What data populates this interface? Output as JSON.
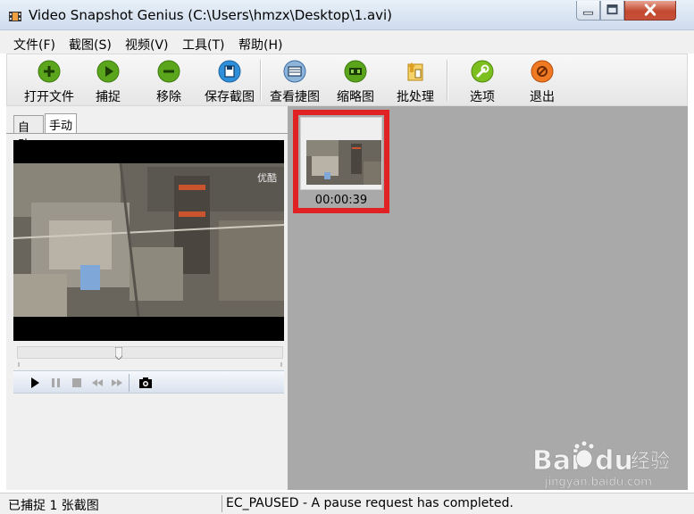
{
  "window": {
    "title": "Video Snapshot Genius (C:\\Users\\hmzx\\Desktop\\1.avi)"
  },
  "menu": {
    "items": [
      {
        "label": "文件(F)"
      },
      {
        "label": "截图(S)"
      },
      {
        "label": "视频(V)"
      },
      {
        "label": "工具(T)"
      },
      {
        "label": "帮助(H)"
      }
    ]
  },
  "toolbar": {
    "buttons": [
      {
        "label": "打开文件",
        "icon": "plus-icon",
        "color": "#5aa51b"
      },
      {
        "label": "捕捉",
        "icon": "play-icon",
        "color": "#5aa51b"
      },
      {
        "label": "移除",
        "icon": "minus-icon",
        "color": "#5aa51b"
      },
      {
        "label": "保存截图",
        "icon": "save-icon",
        "color": "#2f8fd8"
      },
      {
        "label": "查看捷图",
        "icon": "view-icon",
        "color": "#2f8fd8"
      },
      {
        "label": "缩略图",
        "icon": "thumbnail-icon",
        "color": "#5aa51b"
      },
      {
        "label": "批处理",
        "icon": "batch-icon",
        "color": "#e0a020"
      },
      {
        "label": "选项",
        "icon": "wrench-icon",
        "color": "#7cbf1e"
      },
      {
        "label": "退出",
        "icon": "exit-icon",
        "color": "#f07a22"
      }
    ]
  },
  "tabs": [
    {
      "label": "自动"
    },
    {
      "label": "手动"
    }
  ],
  "video": {
    "watermark_text": "优酷",
    "seek_progress": 0.38
  },
  "snapshots": [
    {
      "time": "00:00:39"
    }
  ],
  "status": {
    "left": "已捕捉 1 张截图",
    "right": "EC_PAUSED - A pause request has completed."
  },
  "colors": {
    "highlight_border": "#e02224",
    "right_panel_bg": "#a9a9a9"
  }
}
